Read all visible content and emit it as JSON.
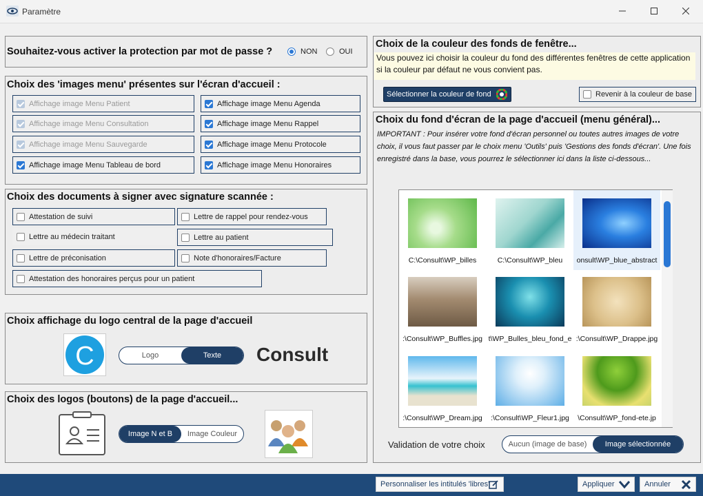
{
  "window": {
    "title": "Paramètre"
  },
  "password": {
    "question": "Souhaitez-vous activer la protection par mot de passe ?",
    "options": [
      "NON",
      "OUI"
    ],
    "selected": "NON"
  },
  "menu_images": {
    "title": "Choix des 'images menu' présentes sur l'écran d'accueil :",
    "items": [
      {
        "label": "Affichage image Menu Patient",
        "checked": true,
        "disabled": true
      },
      {
        "label": "Affichage image Menu Agenda",
        "checked": true,
        "disabled": false
      },
      {
        "label": "Affichage image Menu Consultation",
        "checked": true,
        "disabled": true
      },
      {
        "label": "Affichage image Menu Rappel",
        "checked": true,
        "disabled": false
      },
      {
        "label": "Affichage image Menu Sauvegarde",
        "checked": true,
        "disabled": true
      },
      {
        "label": "Affichage image Menu Protocole",
        "checked": true,
        "disabled": false
      },
      {
        "label": "Affichage image Menu Tableau de bord",
        "checked": true,
        "disabled": false
      },
      {
        "label": "Affichage image Menu Honoraires",
        "checked": true,
        "disabled": false
      }
    ]
  },
  "documents": {
    "title": "Choix des documents à signer avec signature scannée :",
    "items": [
      {
        "label": "Attestation de suivi",
        "checked": false
      },
      {
        "label": "Lettre de rappel pour rendez-vous",
        "checked": false
      },
      {
        "label": "Lettre au médecin traitant",
        "checked": false
      },
      {
        "label": "Lettre au patient",
        "checked": false
      },
      {
        "label": "Lettre de préconisation",
        "checked": false
      },
      {
        "label": "Note d'honoraires/Facture",
        "checked": false
      },
      {
        "label": "Attestation des honoraires perçus pour un patient",
        "checked": false
      }
    ]
  },
  "logo_central": {
    "title": "Choix affichage du logo central de la page d'accueil",
    "toggle": [
      "Logo",
      "Texte"
    ],
    "selected": "Texte",
    "preview_text": "Consult",
    "logo_letter": "C"
  },
  "logos_buttons": {
    "title": "Choix des logos (boutons) de la page d'accueil...",
    "toggle": [
      "Image N et B",
      "Image Couleur"
    ],
    "selected": "Image N et B"
  },
  "couleur": {
    "title": "Choix de la couleur des fonds de fenêtre...",
    "info": "Vous pouvez ici choisir la couleur du fond des différentes fenêtres de cette application si la couleur par défaut ne vous convient pas.",
    "select_button": "Sélectionner la couleur de fond",
    "reset_label": "Revenir à la couleur de base",
    "reset_checked": false
  },
  "fond_ecran": {
    "title": "Choix du fond d'écran de la page d'accueil (menu général)...",
    "important": "IMPORTANT : Pour insérer votre fond d'écran personnel ou toutes autres images de votre choix, il vous faut passer par le choix menu 'Outils' puis 'Gestions des fonds d'écran'. Une fois enregistré dans la base, vous pourrez le sélectionner ici dans la liste ci-dessous...",
    "thumbnails": [
      {
        "caption": "C:\\Consult\\WP_billes",
        "selected": false
      },
      {
        "caption": "C:\\Consult\\WP_bleu",
        "selected": false
      },
      {
        "caption": "onsult\\WP_blue_abstract",
        "selected": true
      },
      {
        "caption": ":\\Consult\\WP_Buffles.jpg",
        "selected": false
      },
      {
        "caption": "t\\WP_Bulles_bleu_fond_e",
        "selected": false
      },
      {
        "caption": ":\\Consult\\WP_Drappe.jpg",
        "selected": false
      },
      {
        "caption": ":\\Consult\\WP_Dream.jpg",
        "selected": false
      },
      {
        "caption": ":\\Consult\\WP_Fleur1.jpg",
        "selected": false
      },
      {
        "caption": "\\Consult\\WP_fond-ete.jp",
        "selected": false
      }
    ],
    "validation_label": "Validation de votre choix",
    "validation_toggle": [
      "Aucun (image de base)",
      "Image sélectionnée"
    ],
    "validation_selected": "Image sélectionnée"
  },
  "footer": {
    "personnaliser": "Personnaliser les intitulés 'libres'",
    "appliquer": "Appliquer",
    "annuler": "Annuler"
  },
  "colors": {
    "accent": "#1f3f66",
    "checkbox": "#2b78d4",
    "footer": "#1f4a7a"
  }
}
